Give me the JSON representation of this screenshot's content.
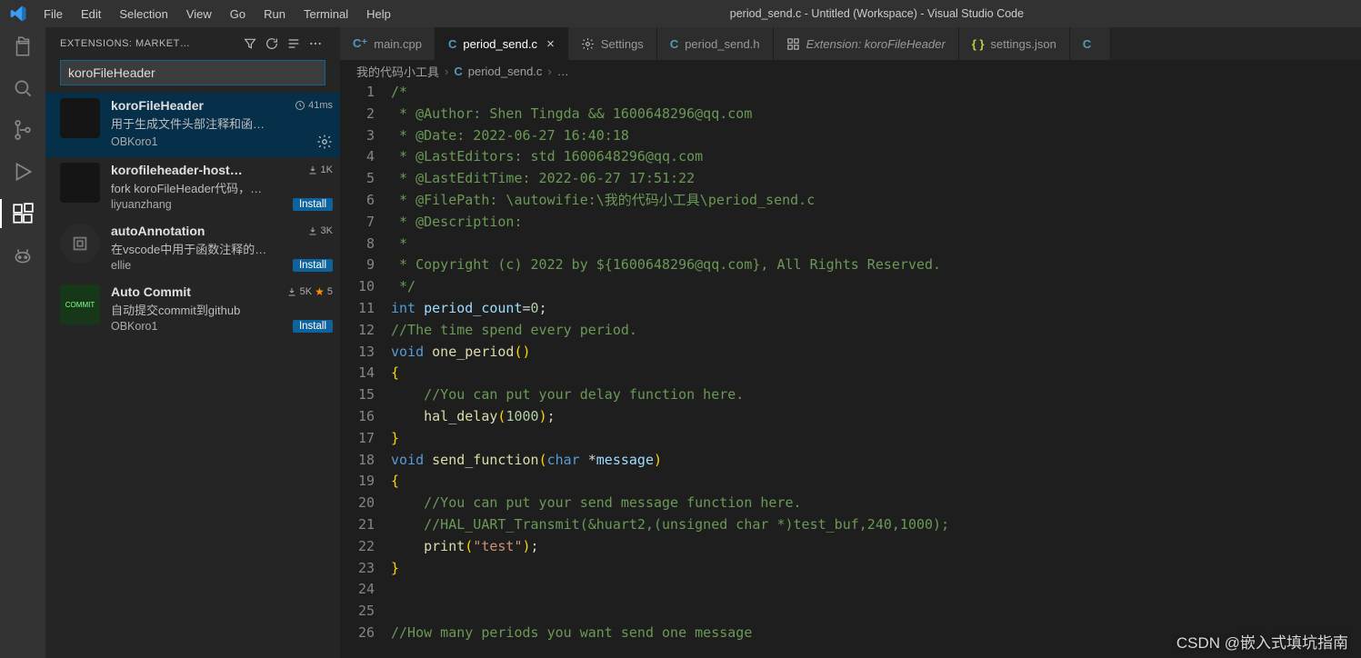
{
  "titlebar": {
    "menus": [
      "File",
      "Edit",
      "Selection",
      "View",
      "Go",
      "Run",
      "Terminal",
      "Help"
    ],
    "window_title": "period_send.c - Untitled (Workspace) - Visual Studio Code"
  },
  "activitybar": {
    "items": [
      "files-icon",
      "search-icon",
      "source-control-icon",
      "debug-icon",
      "extensions-icon",
      "copilot-icon"
    ]
  },
  "sidebar": {
    "header_title": "EXTENSIONS: MARKET…",
    "search_value": "koroFileHeader",
    "install_label": "Install",
    "extensions": [
      {
        "name": "koroFileHeader",
        "meta_icon": "clock",
        "meta_text": "41ms",
        "desc": "用于生成文件头部注释和函…",
        "author": "OBKoro1",
        "action": "gear",
        "selected": true,
        "icon": "dark"
      },
      {
        "name": "korofileheader-host…",
        "meta_icon": "download",
        "meta_text": "1K",
        "desc": "fork koroFileHeader代码，…",
        "author": "liyuanzhang",
        "action": "install",
        "selected": false,
        "icon": "dark"
      },
      {
        "name": "autoAnnotation",
        "meta_icon": "download",
        "meta_text": "3K",
        "desc": "在vscode中用于函数注释的…",
        "author": "ellie",
        "action": "install",
        "selected": false,
        "icon": "round"
      },
      {
        "name": "Auto Commit",
        "meta_icon": "download",
        "meta_text": "5K",
        "meta_extra": "★ 5",
        "desc": "自动提交commit到github",
        "author": "OBKoro1",
        "action": "install",
        "selected": false,
        "icon": "commit"
      }
    ]
  },
  "tabs": [
    {
      "kind": "cpp",
      "label": "main.cpp",
      "active": false
    },
    {
      "kind": "c",
      "label": "period_send.c",
      "active": true,
      "close": true
    },
    {
      "kind": "gear",
      "label": "Settings",
      "active": false
    },
    {
      "kind": "c",
      "label": "period_send.h",
      "active": false
    },
    {
      "kind": "ext",
      "label": "Extension: koroFileHeader",
      "active": false,
      "italic": true
    },
    {
      "kind": "json",
      "label": "settings.json",
      "active": false
    },
    {
      "kind": "c",
      "label": "",
      "active": false,
      "overflow": true
    }
  ],
  "breadcrumbs": {
    "seg1": "我的代码小工具",
    "seg2_kind": "c",
    "seg2": "period_send.c",
    "seg3": "…"
  },
  "code": {
    "lines": [
      {
        "n": 1,
        "t": "comment",
        "txt": "/*"
      },
      {
        "n": 2,
        "t": "comment",
        "txt": " * @Author: Shen Tingda && 1600648296@qq.com"
      },
      {
        "n": 3,
        "t": "comment",
        "txt": " * @Date: 2022-06-27 16:40:18"
      },
      {
        "n": 4,
        "t": "comment",
        "txt": " * @LastEditors: std 1600648296@qq.com"
      },
      {
        "n": 5,
        "t": "comment",
        "txt": " * @LastEditTime: 2022-06-27 17:51:22"
      },
      {
        "n": 6,
        "t": "comment",
        "txt": " * @FilePath: \\autowifie:\\我的代码小工具\\period_send.c"
      },
      {
        "n": 7,
        "t": "comment",
        "txt": " * @Description: "
      },
      {
        "n": 8,
        "t": "comment",
        "txt": " * "
      },
      {
        "n": 9,
        "t": "comment",
        "txt": " * Copyright (c) 2022 by ${1600648296@qq.com}, All Rights Reserved. "
      },
      {
        "n": 10,
        "t": "comment",
        "txt": " */"
      },
      {
        "n": 11,
        "t": "code",
        "parts": [
          [
            "keyword",
            "int"
          ],
          [
            "white",
            " "
          ],
          [
            "ident",
            "period_count"
          ],
          [
            "op",
            "="
          ],
          [
            "num",
            "0"
          ],
          [
            "white",
            ";"
          ]
        ]
      },
      {
        "n": 12,
        "t": "comment",
        "txt": "//The time spend every period."
      },
      {
        "n": 13,
        "t": "code",
        "parts": [
          [
            "keyword",
            "void"
          ],
          [
            "white",
            " "
          ],
          [
            "func",
            "one_period"
          ],
          [
            "punc",
            "()"
          ]
        ]
      },
      {
        "n": 14,
        "t": "code",
        "parts": [
          [
            "punc",
            "{"
          ]
        ]
      },
      {
        "n": 15,
        "t": "code",
        "parts": [
          [
            "white",
            "    "
          ],
          [
            "comment",
            "//You can put your delay function here."
          ]
        ]
      },
      {
        "n": 16,
        "t": "code",
        "parts": [
          [
            "white",
            "    "
          ],
          [
            "func",
            "hal_delay"
          ],
          [
            "punc",
            "("
          ],
          [
            "num",
            "1000"
          ],
          [
            "punc",
            ")"
          ],
          [
            "white",
            ";"
          ]
        ]
      },
      {
        "n": 17,
        "t": "code",
        "parts": [
          [
            "punc",
            "}"
          ]
        ]
      },
      {
        "n": 18,
        "t": "code",
        "parts": [
          [
            "keyword",
            "void"
          ],
          [
            "white",
            " "
          ],
          [
            "func",
            "send_function"
          ],
          [
            "punc",
            "("
          ],
          [
            "keyword",
            "char"
          ],
          [
            "white",
            " "
          ],
          [
            "op",
            "*"
          ],
          [
            "param",
            "message"
          ],
          [
            "punc",
            ")"
          ]
        ]
      },
      {
        "n": 19,
        "t": "code",
        "parts": [
          [
            "punc",
            "{"
          ]
        ]
      },
      {
        "n": 20,
        "t": "code",
        "parts": [
          [
            "white",
            "    "
          ],
          [
            "comment",
            "//You can put your send message function here."
          ]
        ]
      },
      {
        "n": 21,
        "t": "code",
        "parts": [
          [
            "white",
            "    "
          ],
          [
            "comment",
            "//HAL_UART_Transmit(&huart2,(unsigned char *)test_buf,240,1000);"
          ]
        ]
      },
      {
        "n": 22,
        "t": "code",
        "parts": [
          [
            "white",
            "    "
          ],
          [
            "func",
            "print"
          ],
          [
            "punc",
            "("
          ],
          [
            "str",
            "\"test\""
          ],
          [
            "punc",
            ")"
          ],
          [
            "white",
            ";"
          ]
        ]
      },
      {
        "n": 23,
        "t": "code",
        "parts": [
          [
            "punc",
            "}"
          ]
        ]
      },
      {
        "n": 24,
        "t": "blank",
        "txt": ""
      },
      {
        "n": 25,
        "t": "blank",
        "txt": ""
      },
      {
        "n": 26,
        "t": "comment",
        "txt": "//How many periods you want send one message"
      }
    ]
  },
  "watermark": "CSDN @嵌入式填坑指南"
}
